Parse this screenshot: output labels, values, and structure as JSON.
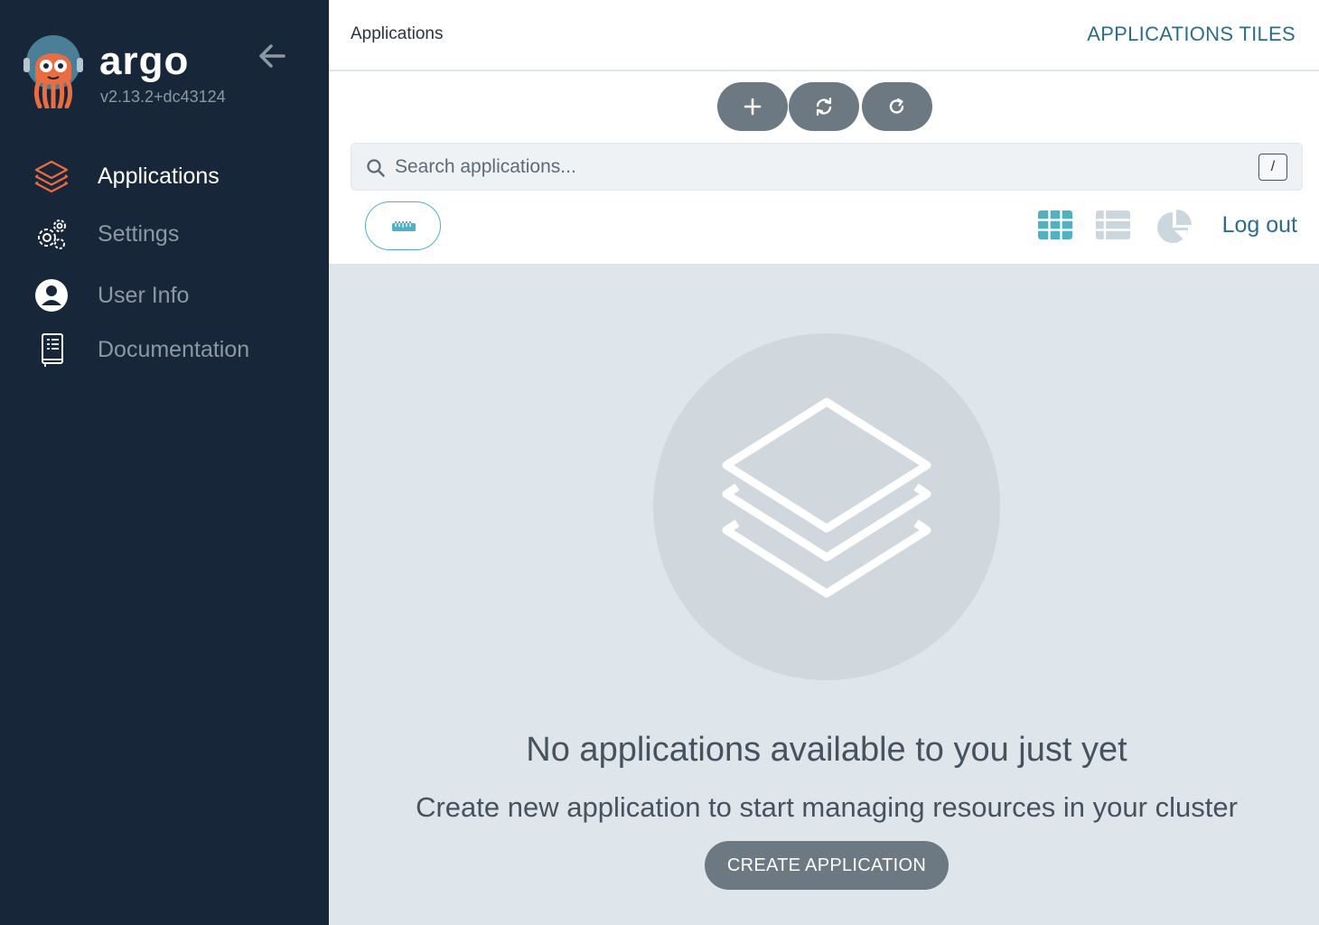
{
  "app": {
    "brand": "argo",
    "version": "v2.13.2+dc43124"
  },
  "sidebar": {
    "collapse_icon": "arrow-left-icon",
    "items": [
      {
        "label": "Applications",
        "icon": "layers-icon",
        "active": true
      },
      {
        "label": "Settings",
        "icon": "gears-icon",
        "active": false
      },
      {
        "label": "User Info",
        "icon": "user-circle-icon",
        "active": false
      },
      {
        "label": "Documentation",
        "icon": "book-icon",
        "active": false
      }
    ]
  },
  "topbar": {
    "breadcrumb": "Applications",
    "page_heading": "APPLICATIONS TILES"
  },
  "toolbar": {
    "buttons": [
      "plus-icon",
      "sync-icon",
      "refresh-icon"
    ],
    "search": {
      "placeholder": "Search applications...",
      "value": "",
      "shortcut": "/"
    },
    "filter_icon": "ruler-icon",
    "views": [
      {
        "icon": "tiles-icon",
        "active": true
      },
      {
        "icon": "list-icon",
        "active": false
      },
      {
        "icon": "pie-chart-icon",
        "active": false
      }
    ],
    "logout_label": "Log out"
  },
  "empty_state": {
    "icon": "layers-icon",
    "title": "No applications available to you just yet",
    "subtitle": "Create new application to start managing resources in your cluster",
    "button_label": "CREATE APPLICATION"
  },
  "colors": {
    "sidebar_bg": "#18263a",
    "accent": "#4fb1c1",
    "link": "#2d6e86",
    "button_bg": "#6c7882",
    "logo_orange": "#e96d40",
    "content_bg": "#dee6eb"
  }
}
